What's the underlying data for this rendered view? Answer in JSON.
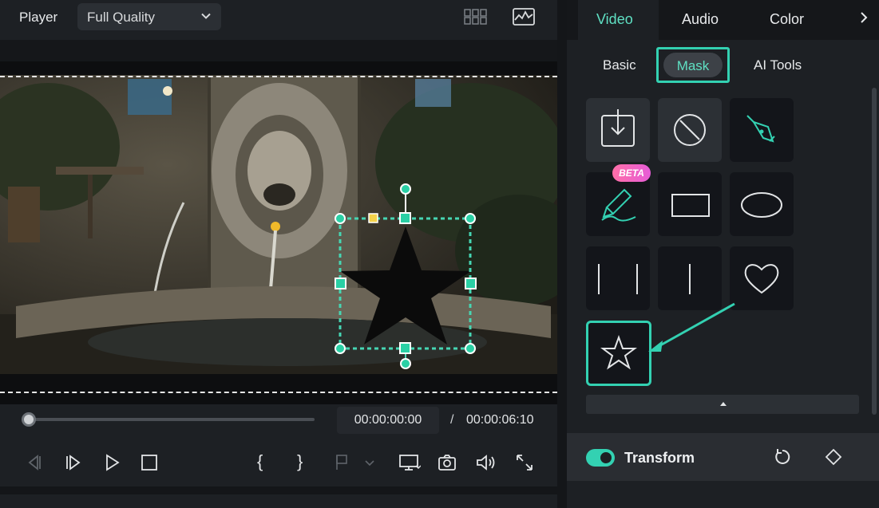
{
  "player": {
    "title": "Player",
    "quality": "Full Quality",
    "icons": [
      "grid-view-icon",
      "waveform-monitor-icon"
    ]
  },
  "timeline": {
    "current_time": "00:00:00:00",
    "separator": "/",
    "total_time": "00:00:06:10",
    "progress": 0
  },
  "controls": [
    "previous-frame-icon",
    "next-frame-icon",
    "play-icon",
    "stop-icon",
    "mark-in-icon",
    "mark-out-icon",
    "add-marker-icon",
    "display-icon",
    "snapshot-icon",
    "volume-icon",
    "fullscreen-icon"
  ],
  "mark_in_glyph": "{",
  "mark_out_glyph": "}",
  "tabs": [
    {
      "label": "Video",
      "active": true
    },
    {
      "label": "Audio",
      "active": false
    },
    {
      "label": "Color",
      "active": false
    }
  ],
  "subtabs": [
    {
      "label": "Basic",
      "active": false
    },
    {
      "label": "Mask",
      "active": true
    },
    {
      "label": "AI Tools",
      "active": false
    }
  ],
  "mask_shapes": [
    "import-mask-icon",
    "no-mask-icon",
    "pen-tool-icon",
    "brush-mask-icon",
    "rectangle-icon",
    "ellipse-icon",
    "double-line-icon",
    "single-line-icon",
    "heart-icon",
    "star-icon"
  ],
  "beta_badge": "BETA",
  "transform": {
    "label": "Transform",
    "enabled": true
  },
  "colors": {
    "accent": "#33d1b2",
    "accent_text": "#5fe0c3",
    "panel": "#1d2024",
    "dark": "#15171a"
  }
}
